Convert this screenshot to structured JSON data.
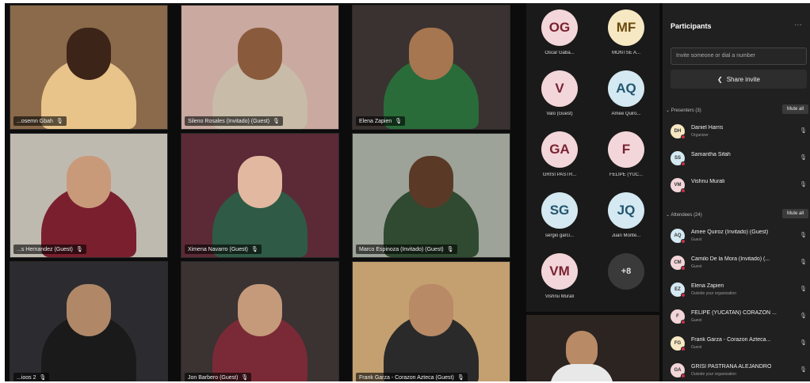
{
  "tiles": [
    {
      "name": "...osemn Gbah",
      "bg": "#8a6a4a",
      "shirt": "#e8c38a",
      "skin": "#3d2418"
    },
    {
      "name": "Sileno Rosales (Invitado) (Guest)",
      "bg": "#c9a9a0",
      "shirt": "#c8bba8",
      "skin": "#8a5a3c"
    },
    {
      "name": "Elena Zapien",
      "bg": "#3a3230",
      "shirt": "#2a6b3a",
      "skin": "#a67650"
    },
    {
      "name": "...s Hernandez (Guest)",
      "bg": "#bfbab0",
      "shirt": "#7a1f2e",
      "skin": "#c99a7a"
    },
    {
      "name": "Ximena Navarro (Guest)",
      "bg": "#5b2a36",
      "shirt": "#2f5a46",
      "skin": "#e2b8a0"
    },
    {
      "name": "Marco Espinoza (Invitado) (Guest)",
      "bg": "#9ea39a",
      "shirt": "#2f4a30",
      "skin": "#5a3a26"
    },
    {
      "name": "...ioos 2",
      "bg": "#2c2c30",
      "shirt": "#1a1a1a",
      "skin": "#b08868"
    },
    {
      "name": "Jon Barbero (Guest)",
      "bg": "#3b3232",
      "shirt": "#7a2a36",
      "skin": "#c49a7a"
    },
    {
      "name": "Frank Garza - Corazon Azteca (Guest)",
      "bg": "#c4a070",
      "shirt": "#2a2a2a",
      "skin": "#b88a66"
    }
  ],
  "avatars": [
    {
      "initials": "OG",
      "label": "Oscar Gaba...",
      "fg": "#7a2232",
      "bgc": "#f3d6d9"
    },
    {
      "initials": "MF",
      "label": "MONTSE A...",
      "fg": "#6a4a10",
      "bgc": "#f6e8c2"
    },
    {
      "initials": "V",
      "label": "Valo (Guest)",
      "fg": "#7a2232",
      "bgc": "#f3d6d9"
    },
    {
      "initials": "AQ",
      "label": "Amee Quiro...",
      "fg": "#23566e",
      "bgc": "#d4e9f1"
    },
    {
      "initials": "GA",
      "label": "GRISI PASTR...",
      "fg": "#7a2232",
      "bgc": "#f3d6d9"
    },
    {
      "initials": "F",
      "label": "FELIPE (YUC...",
      "fg": "#7a2232",
      "bgc": "#f3d6d9"
    },
    {
      "initials": "SG",
      "label": "sergio garci...",
      "fg": "#23566e",
      "bgc": "#d4e9f1"
    },
    {
      "initials": "JQ",
      "label": "Juan Monte...",
      "fg": "#23566e",
      "bgc": "#d4e9f1"
    },
    {
      "initials": "VM",
      "label": "Vishnu Murali",
      "fg": "#7a2232",
      "bgc": "#f3d6d9"
    },
    {
      "initials": "+8",
      "label": "",
      "fg": "#dddddd",
      "bgc": "#3a3a3a"
    }
  ],
  "panel": {
    "title": "Participants",
    "more": "···",
    "invite_placeholder": "Invite someone or dial a number",
    "share_label": "Share invite",
    "presenters_label": "Presenters (3)",
    "attendees_label": "Attendees (24)",
    "mute_all": "Mute all",
    "presenters": [
      {
        "initials": "DH",
        "name": "Daniel Harris",
        "role": "Organizer",
        "color": "#f6e8c2"
      },
      {
        "initials": "SS",
        "name": "Samantha Sifah",
        "role": "",
        "color": "#d4e9f1"
      },
      {
        "initials": "VM",
        "name": "Vishnu Murali",
        "role": "",
        "color": "#f3d6d9"
      }
    ],
    "attendees": [
      {
        "initials": "AQ",
        "name": "Amee Quiroz (Invitado) (Guest)",
        "role": "Guest",
        "color": "#d4e9f1"
      },
      {
        "initials": "CM",
        "name": "Camilo De la Mora (Invitado) (...",
        "role": "Guest",
        "color": "#f3d6d9"
      },
      {
        "initials": "EZ",
        "name": "Elena Zapien",
        "role": "Outside your organization",
        "color": "#d4e9f1"
      },
      {
        "initials": "F",
        "name": "FELIPE (YUCATAN) CORAZÓN ...",
        "role": "Guest",
        "color": "#f3d6d9"
      },
      {
        "initials": "FG",
        "name": "Frank Garza - Corazon Azteca...",
        "role": "Guest",
        "color": "#f6e8c2"
      },
      {
        "initials": "GA",
        "name": "GRISI PASTRANA ALEJANDRO",
        "role": "Outside your organization",
        "color": "#f3d6d9"
      }
    ]
  }
}
